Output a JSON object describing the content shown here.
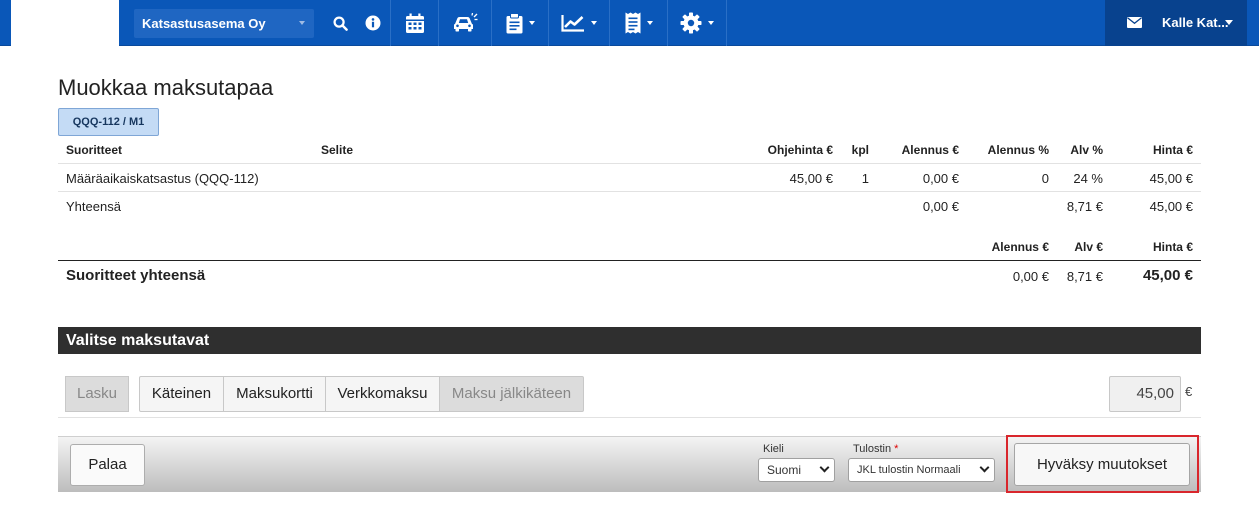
{
  "header": {
    "station": "Katsastusasema Oy",
    "user": "Kalle Kat..."
  },
  "page": {
    "title": "Muokkaa maksutapaa",
    "plate_tab": "QQQ-112 / M1"
  },
  "table": {
    "headers": {
      "suoritteet": "Suoritteet",
      "selite": "Selite",
      "ohjehinta": "Ohjehinta €",
      "kpl": "kpl",
      "alennus_eur": "Alennus €",
      "alennus_pct": "Alennus %",
      "alv_pct": "Alv %",
      "hinta": "Hinta €"
    },
    "rows": [
      {
        "suorite": "Määräaikaiskatsastus (QQQ-112)",
        "ohjehinta": "45,00 €",
        "kpl": "1",
        "alennus_eur": "0,00 €",
        "alennus_pct": "0",
        "alv_pct": "24 %",
        "hinta": "45,00 €"
      }
    ],
    "subtotal": {
      "label": "Yhteensä",
      "alennus_eur": "0,00 €",
      "alv": "8,71 €",
      "hinta": "45,00 €"
    },
    "totals_headers": {
      "alennus": "Alennus €",
      "alv": "Alv €",
      "hinta": "Hinta €"
    },
    "totals": {
      "label": "Suoritteet yhteensä",
      "alennus": "0,00 €",
      "alv": "8,71 €",
      "hinta": "45,00 €"
    }
  },
  "payment": {
    "section_title": "Valitse maksutavat",
    "methods": [
      "Lasku",
      "Käteinen",
      "Maksukortti",
      "Verkkomaksu",
      "Maksu jälkikäteen"
    ],
    "amount": "45,00",
    "currency": "€"
  },
  "footer": {
    "back_label": "Palaa",
    "language_label": "Kieli",
    "language_value": "Suomi",
    "printer_label": "Tulostin",
    "printer_required": "*",
    "printer_value": "JKL tulostin Normaali",
    "approve_label": "Hyväksy muutokset"
  }
}
